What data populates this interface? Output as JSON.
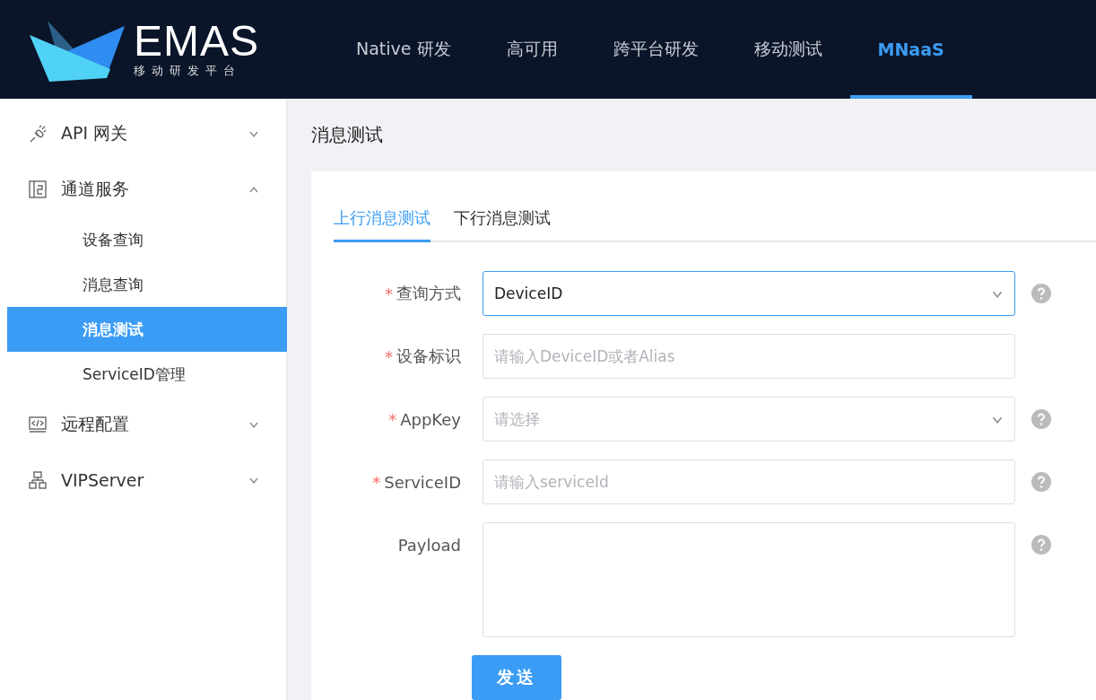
{
  "header": {
    "logo": {
      "name": "EMAS",
      "subtitle": "移动研发平台"
    },
    "nav": [
      {
        "label": "Native 研发",
        "selected": false
      },
      {
        "label": "高可用",
        "selected": false
      },
      {
        "label": "跨平台研发",
        "selected": false
      },
      {
        "label": "移动测试",
        "selected": false
      },
      {
        "label": "MNaaS",
        "selected": true
      }
    ]
  },
  "sidebar": {
    "items": [
      {
        "label": "API 网关",
        "expanded": false
      },
      {
        "label": "通道服务",
        "expanded": true,
        "children": [
          {
            "label": "设备查询",
            "selected": false
          },
          {
            "label": "消息查询",
            "selected": false
          },
          {
            "label": "消息测试",
            "selected": true
          },
          {
            "label": "ServiceID管理",
            "selected": false
          }
        ]
      },
      {
        "label": "远程配置",
        "expanded": false
      },
      {
        "label": "VIPServer",
        "expanded": false
      }
    ]
  },
  "page_title": "消息测试",
  "tabs": [
    {
      "label": "上行消息测试",
      "selected": true
    },
    {
      "label": "下行消息测试",
      "selected": false
    }
  ],
  "form": {
    "fields": [
      {
        "kind": "select",
        "required_mark": "*",
        "label": "查询方式",
        "value": "DeviceID",
        "focused": true,
        "help": true
      },
      {
        "kind": "input",
        "required_mark": "*",
        "label": "设备标识",
        "placeholder": "请输入DeviceID或者Alias",
        "focused": false,
        "help": false
      },
      {
        "kind": "select",
        "required_mark": "*",
        "label": "AppKey",
        "placeholder": "请选择",
        "focused": false,
        "help": true
      },
      {
        "kind": "input",
        "required_mark": "*",
        "label": "ServiceID",
        "placeholder": "请输入serviceId",
        "focused": false,
        "help": true
      },
      {
        "kind": "textarea",
        "label": "Payload",
        "focused": false,
        "help": true
      }
    ],
    "submit": "发送"
  }
}
